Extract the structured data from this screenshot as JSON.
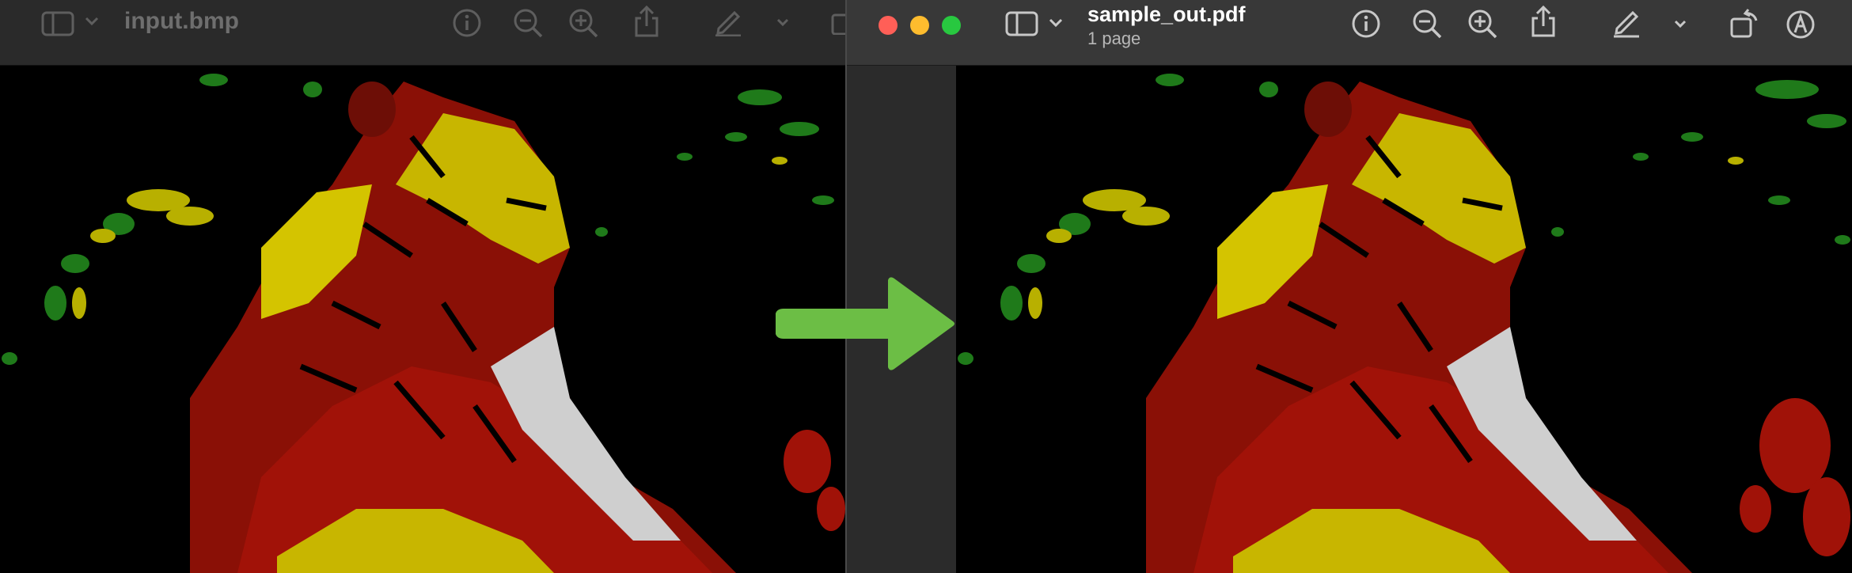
{
  "left_window": {
    "title": "input.bmp",
    "toolbar_icons": [
      "sidebar-icon",
      "chevron-down-icon",
      "info-icon",
      "zoom-out-icon",
      "zoom-in-icon",
      "share-icon",
      "markup-icon",
      "chevron-down-icon"
    ]
  },
  "right_window": {
    "title": "sample_out.pdf",
    "subtitle": "1 page",
    "toolbar_icons": [
      "sidebar-icon",
      "chevron-down-icon",
      "info-icon",
      "zoom-out-icon",
      "zoom-in-icon",
      "share-icon",
      "markup-icon",
      "chevron-down-icon",
      "rotate-icon",
      "annotate-icon"
    ]
  },
  "arrow_icon": "right-arrow-icon",
  "colors": {
    "arrow": "#6cbe45",
    "close": "#ff5f57",
    "minimize": "#febc2e",
    "zoom": "#28c840",
    "toolbar_dark": "#2a2a2a",
    "toolbar_main": "#383838"
  }
}
